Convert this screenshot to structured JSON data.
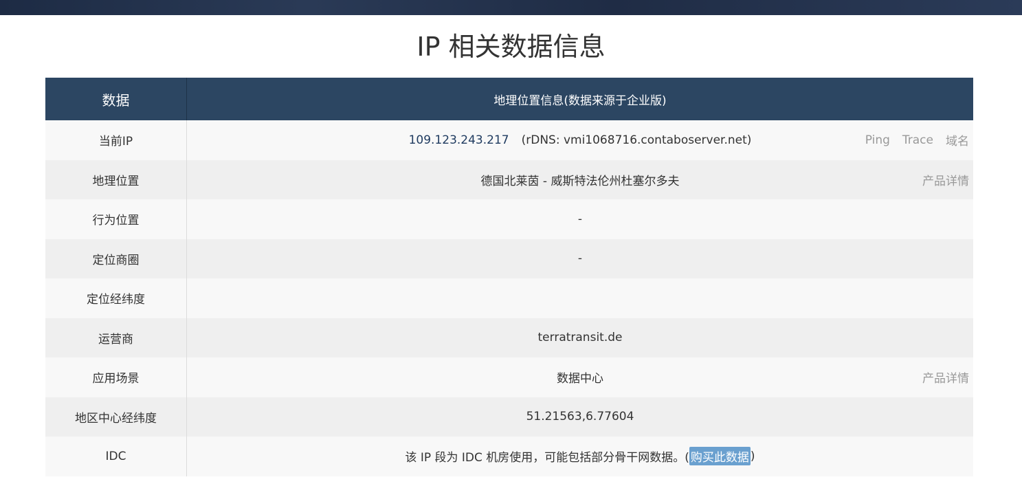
{
  "page": {
    "title": "IP 相关数据信息"
  },
  "table": {
    "header": {
      "key": "数据",
      "value": "地理位置信息(数据来源于企业版)"
    },
    "current_ip": {
      "label": "当前IP",
      "ip": "109.123.243.217",
      "rdns": "(rDNS: vmi1068716.contaboserver.net)",
      "actions": {
        "ping": "Ping",
        "trace": "Trace",
        "domain": "域名"
      }
    },
    "geo": {
      "label": "地理位置",
      "value": "德国北莱茵 - 威斯特法伦州杜塞尔多夫",
      "action": "产品详情"
    },
    "behavior": {
      "label": "行为位置",
      "value": "-"
    },
    "district": {
      "label": "定位商圈",
      "value": "-"
    },
    "latlng": {
      "label": "定位经纬度",
      "value": ""
    },
    "isp": {
      "label": "运营商",
      "value": "terratransit.de"
    },
    "scene": {
      "label": "应用场景",
      "value": "数据中心",
      "action": "产品详情"
    },
    "center": {
      "label": "地区中心经纬度",
      "value": "51.21563,6.77604"
    },
    "idc": {
      "label": "IDC",
      "text_before": "该 IP 段为 IDC 机房使用，可能包括部分骨干网数据。(",
      "buy": "购买此数据",
      "text_after": ")"
    }
  }
}
